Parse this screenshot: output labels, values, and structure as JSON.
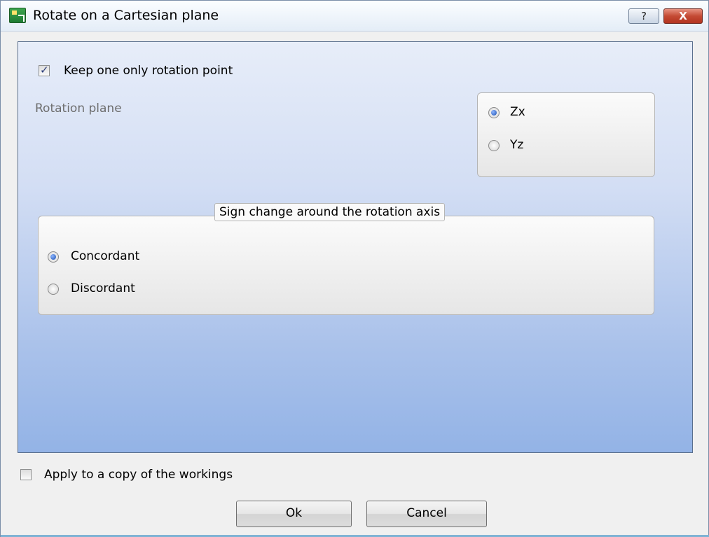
{
  "window": {
    "title": "Rotate on a Cartesian plane",
    "help_label": "?",
    "close_label": "X"
  },
  "options": {
    "keep_one_rotation_point": {
      "label": "Keep one only rotation point",
      "checked": true
    },
    "apply_to_copy": {
      "label": "Apply to a copy of the workings",
      "checked": false
    }
  },
  "rotation_plane": {
    "label": "Rotation plane",
    "options": [
      {
        "label": "Zx",
        "selected": true
      },
      {
        "label": "Yz",
        "selected": false
      }
    ]
  },
  "sign_change": {
    "title": "Sign change around the rotation axis",
    "options": [
      {
        "label": "Concordant",
        "selected": true
      },
      {
        "label": "Discordant",
        "selected": false
      }
    ]
  },
  "buttons": {
    "ok": "Ok",
    "cancel": "Cancel"
  }
}
